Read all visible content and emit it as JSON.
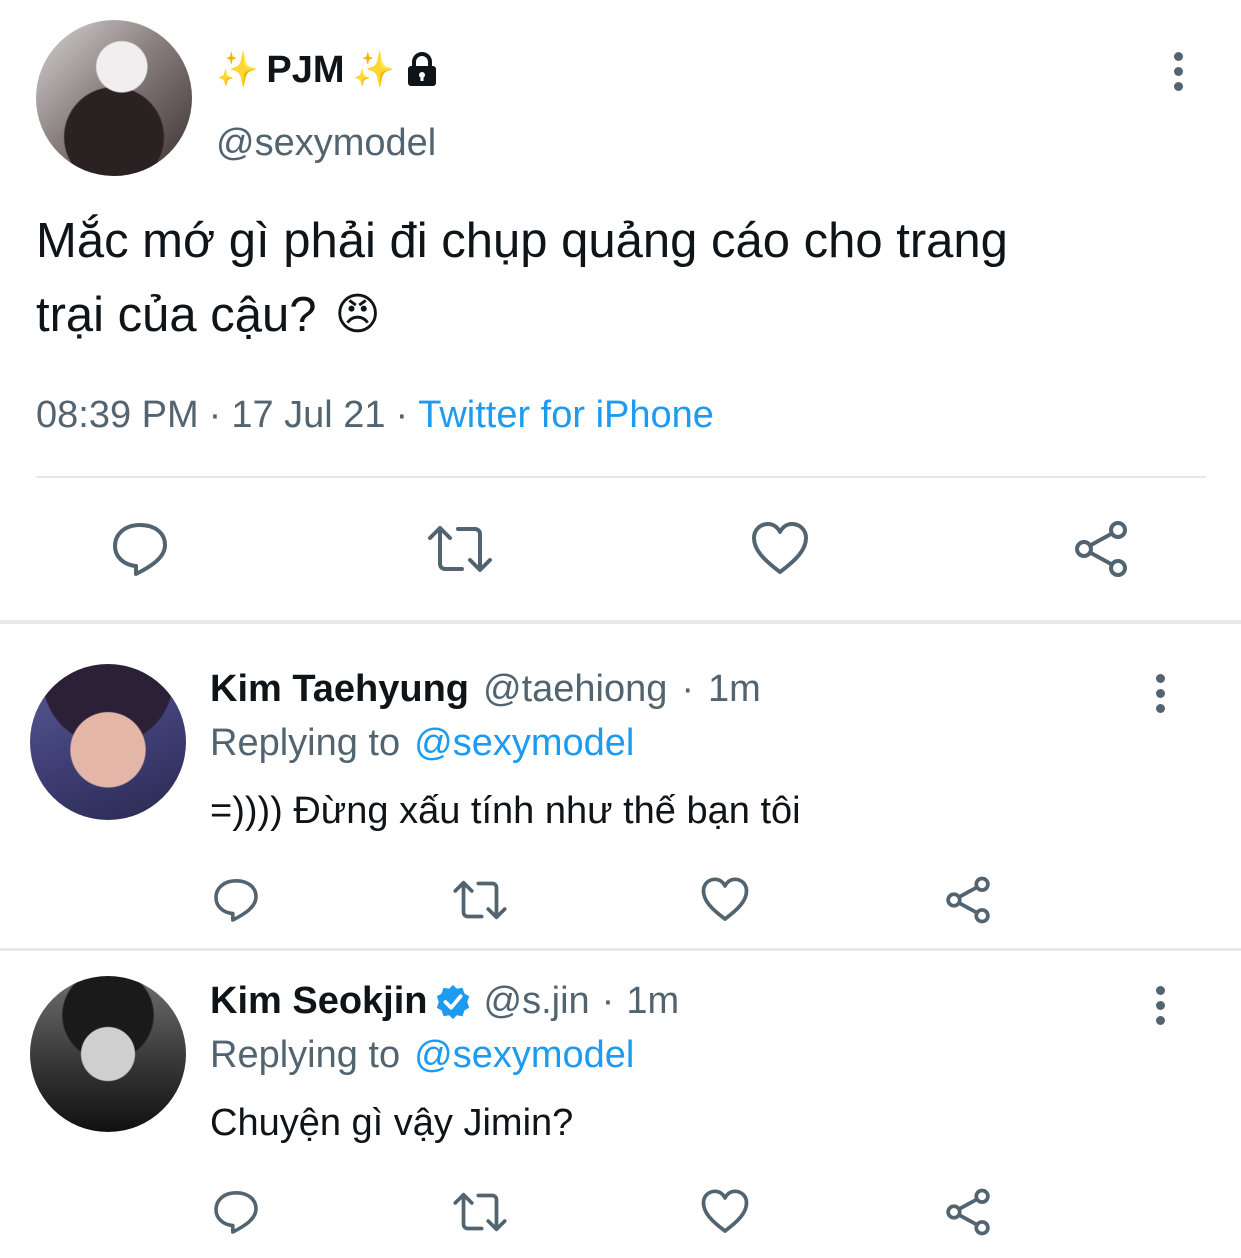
{
  "tweet": {
    "display_name": "PJM",
    "sparkle_left": "✨",
    "sparkle_right": "✨",
    "handle": "@sexymodel",
    "text_line1": "Mắc mớ gì phải đi chụp quảng cáo cho trang",
    "text_line2": "trại của cậu?",
    "emoji": "😠",
    "time": "08:39 PM",
    "sep1": "·",
    "date": "17 Jul 21",
    "sep2": "·",
    "source": "Twitter for iPhone"
  },
  "replies": [
    {
      "name": "Kim Taehyung",
      "handle": "@taehiong",
      "sep": "·",
      "time": "1m",
      "replying_label": "Replying to",
      "replying_handle": "@sexymodel",
      "text": "=)))) Đừng xấu tính như thế bạn tôi"
    },
    {
      "name": "Kim Seokjin",
      "handle": "@s.jin",
      "sep": "·",
      "time": "1m",
      "replying_label": "Replying to",
      "replying_handle": "@sexymodel",
      "text": "Chuyện gì vậy Jimin?"
    }
  ],
  "icons": [
    "reply-icon",
    "retweet-icon",
    "like-icon",
    "share-icon",
    "lock-icon",
    "verified-badge-icon",
    "more-options-icon"
  ],
  "colors": {
    "link": "#1d9bf0",
    "muted": "#536471",
    "text": "#0f1419",
    "icon": "#536471",
    "verified": "#1d9bf0"
  }
}
